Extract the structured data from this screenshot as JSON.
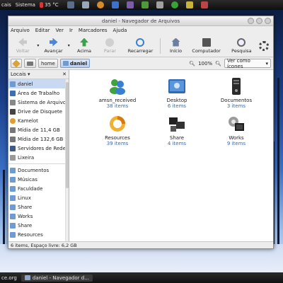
{
  "top_panel": {
    "menu_places": "cais",
    "menu_system": "Sistema",
    "temperature": "35 °C"
  },
  "window": {
    "title": "daniel - Navegador de Arquivos",
    "menu": [
      "Arquivo",
      "Editar",
      "Ver",
      "Ir",
      "Marcadores",
      "Ajuda"
    ],
    "toolbar": {
      "back": "Voltar",
      "forward": "Avançar",
      "up": "Acima",
      "stop": "Parar",
      "reload": "Recarregar",
      "home": "Início",
      "computer": "Computador",
      "search": "Pesquisa"
    },
    "location": {
      "crumbs": [
        "home",
        "daniel"
      ],
      "zoom": "100%",
      "view_mode": "Ver como ícones"
    },
    "sidebar": {
      "title": "Locais",
      "places": [
        "daniel",
        "Área de Trabalho",
        "Sistema de Arquivos",
        "Drive de Disquete",
        "Kamelot",
        "Mídia de 11,4 GB",
        "Mídia de 132,6 GB",
        "Servidores de Rede",
        "Lixeira"
      ],
      "bookmarks": [
        "Documentos",
        "Músicas",
        "Faculdade",
        "Linux",
        "Share",
        "Works",
        "Share",
        "Resources"
      ]
    },
    "files": [
      {
        "name": "amsn_received",
        "info": "38 items",
        "icon": "amsn-icon"
      },
      {
        "name": "Desktop",
        "info": "6 items",
        "icon": "desktop-folder-icon"
      },
      {
        "name": "Documentos",
        "info": "3 items",
        "icon": "documents-folder-icon"
      },
      {
        "name": "Resources",
        "info": "39 items",
        "icon": "resources-folder-icon"
      },
      {
        "name": "Share",
        "info": "4 items",
        "icon": "share-folder-icon"
      },
      {
        "name": "Works",
        "info": "9 items",
        "icon": "works-folder-icon"
      }
    ],
    "status": "6 items, Espaço livre: 6,2 GB"
  },
  "bottom_panel": {
    "left_text": "ce.org",
    "task_label": "daniel - Navegador d..."
  },
  "colors": {
    "selection": "#c9d9f1",
    "accent": "#3e6aa8"
  }
}
